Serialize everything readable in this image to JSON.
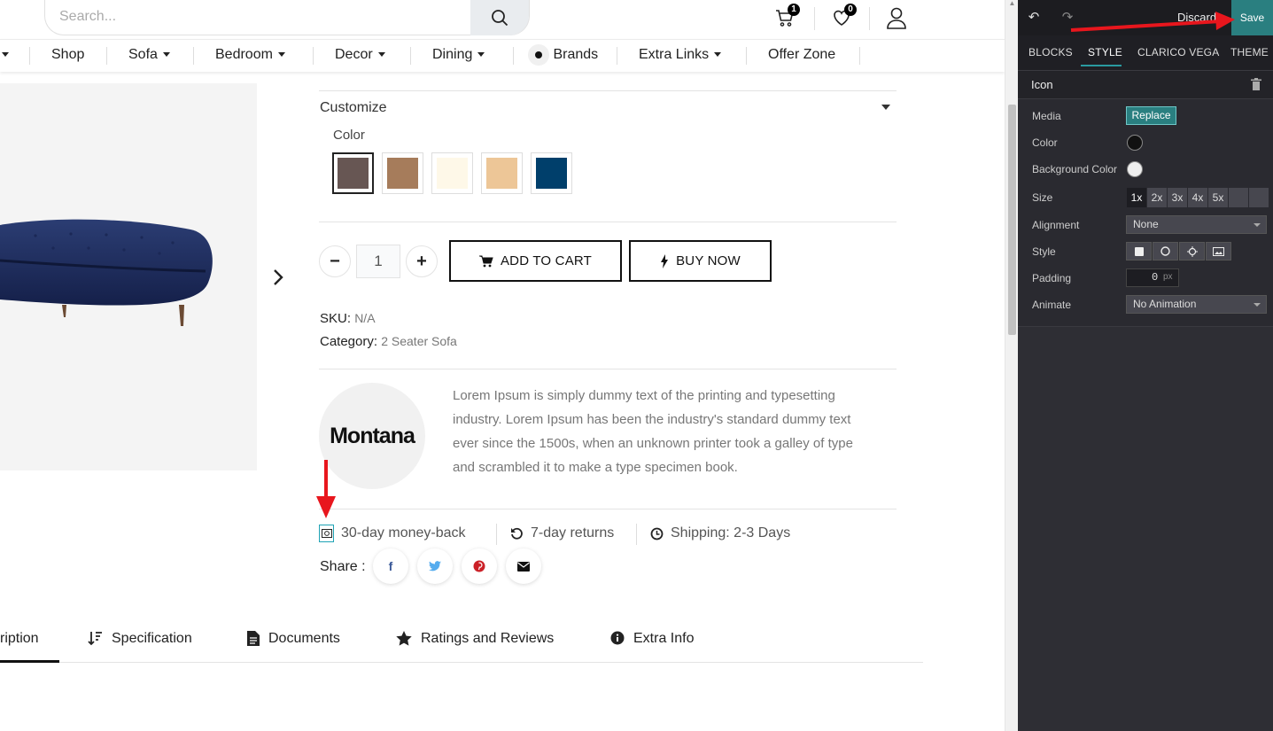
{
  "header": {
    "search_placeholder": "Search...",
    "cart_count": "1",
    "wishlist_count": "0"
  },
  "nav": {
    "items": [
      {
        "label": "Shop",
        "dropdown": false
      },
      {
        "label": "Sofa",
        "dropdown": true
      },
      {
        "label": "Bedroom",
        "dropdown": true
      },
      {
        "label": "Decor",
        "dropdown": true
      },
      {
        "label": "Dining",
        "dropdown": true
      },
      {
        "label": "Brands",
        "dropdown": false
      },
      {
        "label": "Extra Links",
        "dropdown": true
      },
      {
        "label": "Offer Zone",
        "dropdown": false
      }
    ]
  },
  "product": {
    "customize_title": "Customize",
    "color_label": "Color",
    "colors": [
      "#675653",
      "#a67c5b",
      "#fef8e8",
      "#edc697",
      "#003f6b"
    ],
    "quantity": "1",
    "add_to_cart": "ADD TO CART",
    "buy_now": "BUY NOW",
    "sku_label": "SKU:",
    "sku_value": "N/A",
    "category_label": "Category:",
    "category_value": "2 Seater Sofa",
    "brand_name": "Montana",
    "description": "Lorem Ipsum is simply dummy text of the printing and typesetting industry. Lorem Ipsum has been the industry's standard dummy text ever since the 1500s, when an unknown printer took a galley of type and scrambled it to make a type specimen book.",
    "features": [
      "30-day money-back",
      "7-day returns",
      "Shipping: 2-3 Days"
    ],
    "share_label": "Share :"
  },
  "tabs": [
    "ription",
    "Specification",
    "Documents",
    "Ratings and Reviews",
    "Extra Info"
  ],
  "editor": {
    "discard": "Discard",
    "save": "Save",
    "tabs": [
      "BLOCKS",
      "STYLE",
      "CLARICO VEGA",
      "THEME"
    ],
    "section_title": "Icon",
    "media_label": "Media",
    "replace": "Replace",
    "color_label": "Color",
    "bg_color_label": "Background Color",
    "size_label": "Size",
    "sizes": [
      "1x",
      "2x",
      "3x",
      "4x",
      "5x"
    ],
    "alignment_label": "Alignment",
    "alignment_value": "None",
    "style_label": "Style",
    "padding_label": "Padding",
    "padding_value": "0",
    "padding_unit": "px",
    "animate_label": "Animate",
    "animate_value": "No Animation",
    "accent": "#2a7f80"
  }
}
